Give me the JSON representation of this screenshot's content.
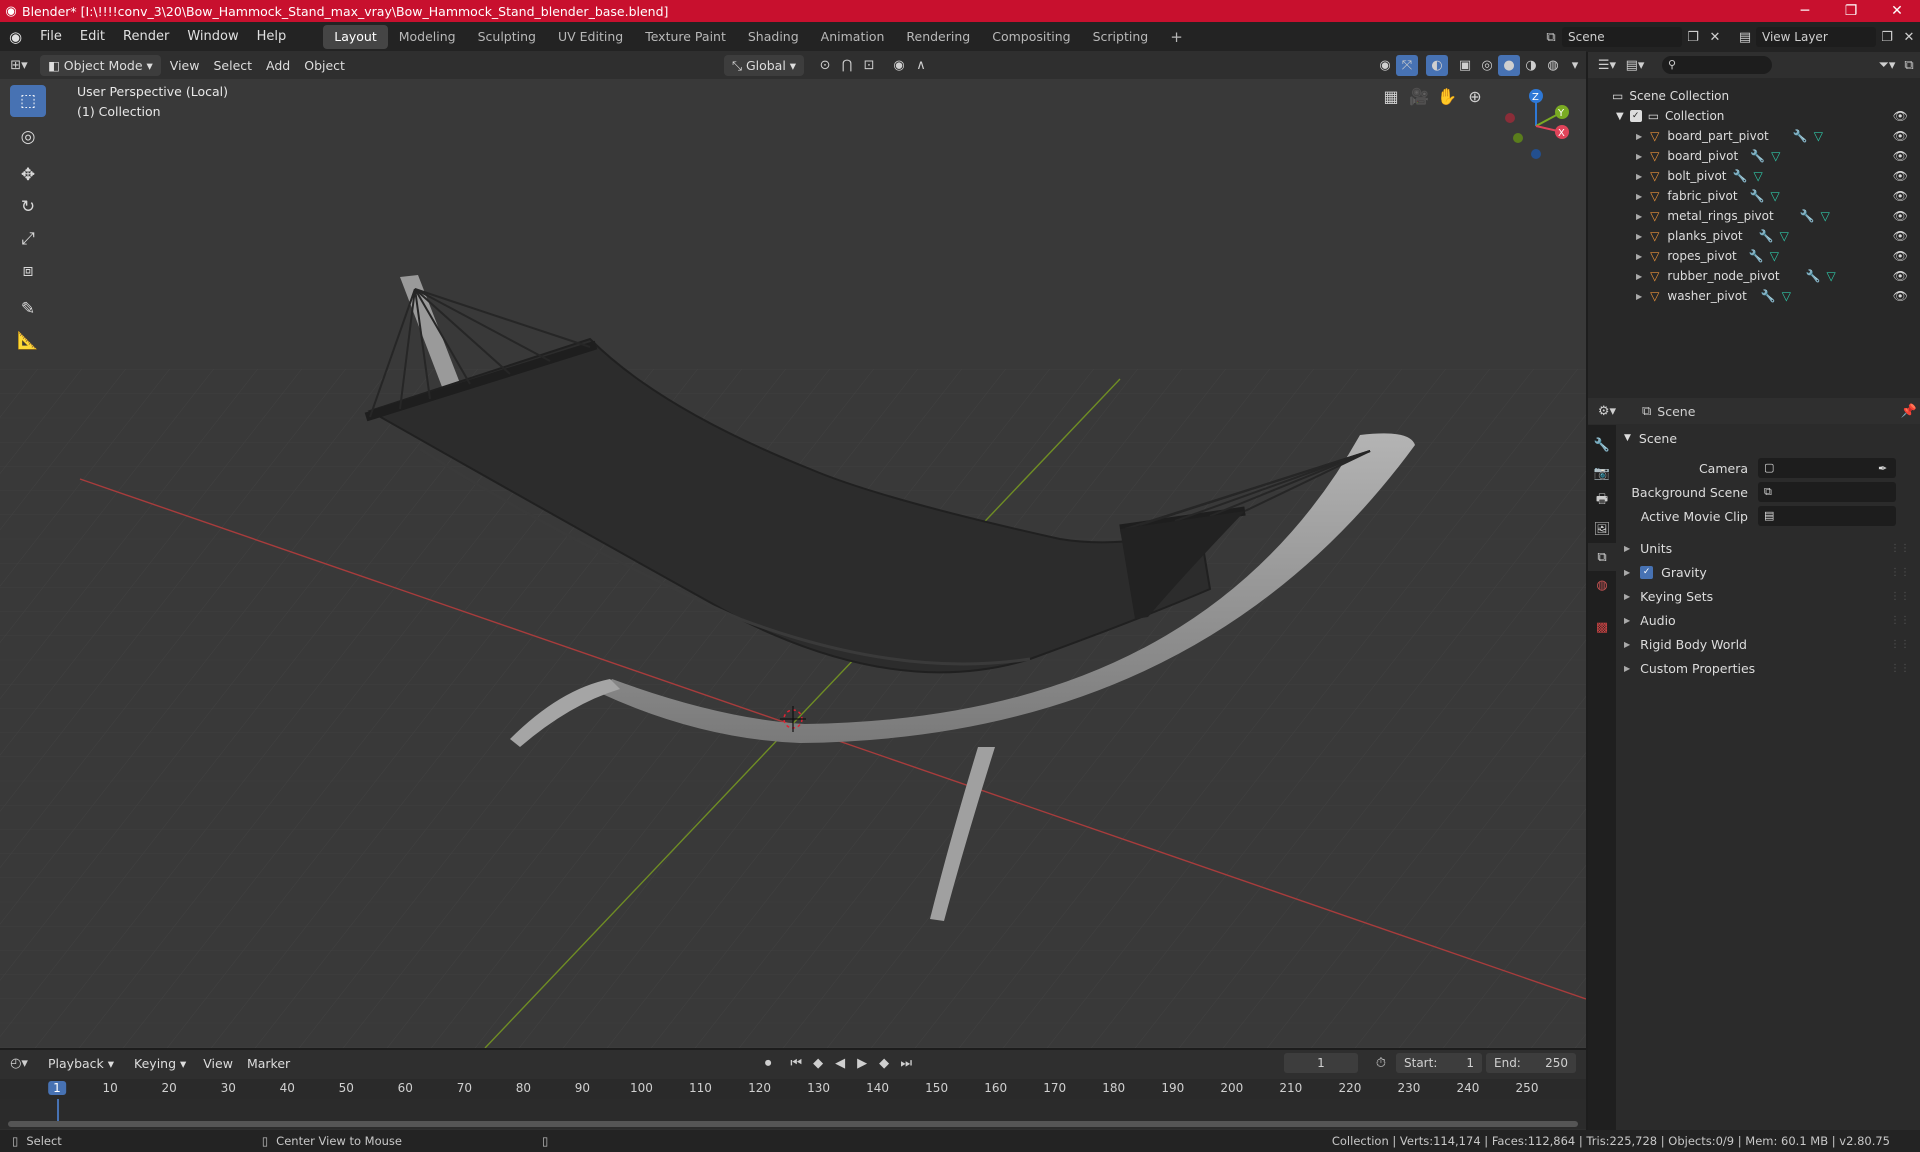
{
  "window": {
    "title": "Blender* [I:\\!!!!conv_3\\20\\Bow_Hammock_Stand_max_vray\\Bow_Hammock_Stand_blender_base.blend]",
    "minimize": "─",
    "maximize": "❐",
    "close": "✕"
  },
  "menus": [
    "File",
    "Edit",
    "Render",
    "Window",
    "Help"
  ],
  "workspaces": [
    "Layout",
    "Modeling",
    "Sculpting",
    "UV Editing",
    "Texture Paint",
    "Shading",
    "Animation",
    "Rendering",
    "Compositing",
    "Scripting"
  ],
  "scene": {
    "name": "Scene",
    "view_layer": "View Layer"
  },
  "viewport_header": {
    "mode": "Object Mode",
    "view": "View",
    "select": "Select",
    "add": "Add",
    "object": "Object",
    "orientation": "Global"
  },
  "viewport_overlay": {
    "perspective": "User Perspective (Local)",
    "collection": "(1) Collection"
  },
  "gizmo": {
    "x": "X",
    "y": "Y",
    "z": "Z"
  },
  "outliner": {
    "root": "Scene Collection",
    "collection": "Collection",
    "objects": [
      "board_part_pivot",
      "board_pivot",
      "bolt_pivot",
      "fabric_pivot",
      "metal_rings_pivot",
      "planks_pivot",
      "ropes_pivot",
      "rubber_node_pivot",
      "washer_pivot"
    ]
  },
  "properties": {
    "context": "Scene",
    "panel": "Scene",
    "camera_label": "Camera",
    "background_scene_label": "Background Scene",
    "active_movie_clip_label": "Active Movie Clip",
    "sections": [
      "Units",
      "Gravity",
      "Keying Sets",
      "Audio",
      "Rigid Body World",
      "Custom Properties"
    ]
  },
  "timeline": {
    "playback": "Playback",
    "keying": "Keying",
    "view": "View",
    "marker": "Marker",
    "current_frame": "1",
    "start_label": "Start:",
    "start": "1",
    "end_label": "End:",
    "end": "250",
    "ticks": [
      "1",
      "10",
      "20",
      "30",
      "40",
      "50",
      "60",
      "70",
      "80",
      "90",
      "100",
      "110",
      "120",
      "130",
      "140",
      "150",
      "160",
      "170",
      "180",
      "190",
      "200",
      "210",
      "220",
      "230",
      "240",
      "250"
    ]
  },
  "status": {
    "select": "Select",
    "center": "Center View to Mouse",
    "stats": "Collection | Verts:114,174 | Faces:112,864 | Tris:225,728 | Objects:0/9 | Mem: 60.1 MB | v2.80.75"
  },
  "colors": {
    "title_bar": "#c8102e",
    "accent": "#4772b3",
    "object_icon": "#e8913a",
    "mesh_icon": "#2fc6a6",
    "modifier_icon": "#6fa0e8"
  }
}
